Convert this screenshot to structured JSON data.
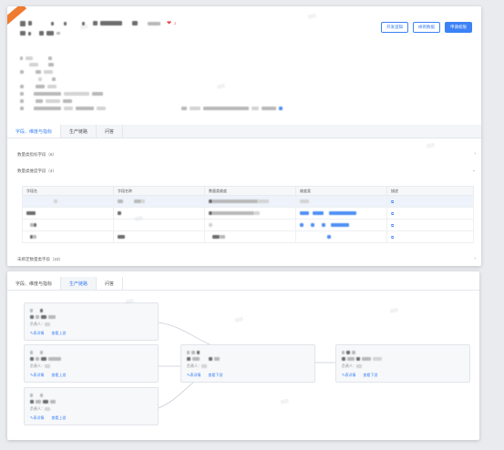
{
  "header": {
    "badge": "",
    "heart_count": "2",
    "buttons": {
      "dev_logic": "开发逻辑",
      "sample_data": "样例数据",
      "apply_permission": "申请权限"
    }
  },
  "tabs_top": [
    "字段、维度与指标",
    "生产链路",
    "问答"
  ],
  "sections": {
    "metrics": "数量类指标字段（6）",
    "dimensions": "数量类维度字段（4）",
    "unused": "未绑定数量类字段（23）"
  },
  "table": {
    "headers": [
      "字段名",
      "字段名称",
      "数量类维度",
      "维度类",
      "描述"
    ]
  },
  "tabs_bottom": [
    "字段、维度与指标",
    "生产链路",
    "问答"
  ],
  "nodes": {
    "owner_label": "负责人：",
    "action_detail": "表详情",
    "action_upstream": "查看上游",
    "action_downstream": "查看下游"
  },
  "colors": {
    "accent": "#3b82f6",
    "badge": "#f07a2f",
    "heart": "#e84a4a"
  },
  "icons": {
    "heart": "heart-icon",
    "chevron": "chevron-icon",
    "edit": "pencil-icon",
    "link": "link-icon"
  }
}
